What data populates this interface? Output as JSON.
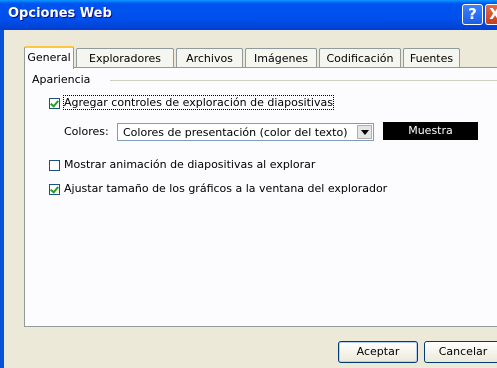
{
  "window": {
    "title": "Opciones Web",
    "help_glyph": "?",
    "close_glyph": "X"
  },
  "tabs": [
    {
      "label": "General",
      "active": true
    },
    {
      "label": "Exploradores"
    },
    {
      "label": "Archivos"
    },
    {
      "label": "Imágenes"
    },
    {
      "label": "Codificación"
    },
    {
      "label": "Fuentes"
    }
  ],
  "appearance": {
    "group_label": "Apariencia",
    "add_controls": {
      "label": "Agregar controles de exploración de diapositivas",
      "checked": true
    },
    "colors": {
      "label": "Colores:",
      "selected": "Colores de presentación (color del texto)",
      "sample": "Muestra"
    },
    "show_animation": {
      "label": "Mostrar animación de diapositivas al explorar",
      "checked": false
    },
    "resize_graphics": {
      "label": "Ajustar tamaño de los gráficos a la ventana del explorador",
      "checked": true
    }
  },
  "buttons": {
    "ok": "Aceptar",
    "cancel": "Cancelar"
  }
}
